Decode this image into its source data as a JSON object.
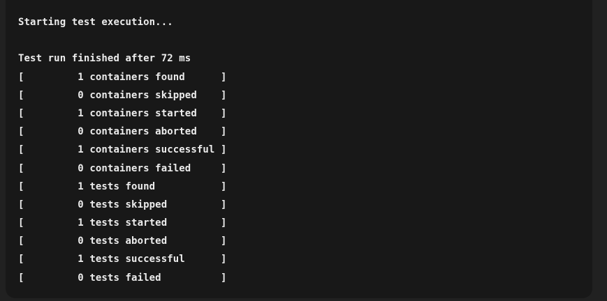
{
  "console": {
    "lines": [
      "Starting test execution...",
      "",
      "Test run finished after 72 ms",
      "[         1 containers found      ]",
      "[         0 containers skipped    ]",
      "[         1 containers started    ]",
      "[         0 containers aborted    ]",
      "[         1 containers successful ]",
      "[         0 containers failed     ]",
      "[         1 tests found           ]",
      "[         0 tests skipped         ]",
      "[         1 tests started         ]",
      "[         0 tests aborted         ]",
      "[         1 tests successful      ]",
      "[         0 tests failed          ]"
    ]
  }
}
